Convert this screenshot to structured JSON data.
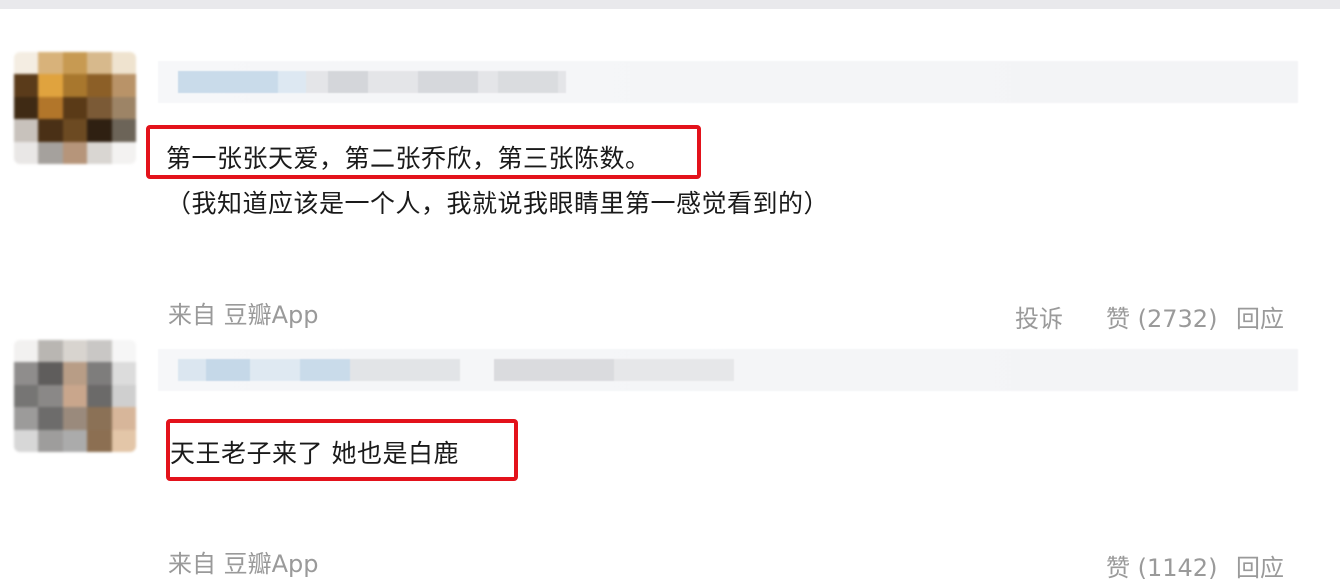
{
  "comments": [
    {
      "line1": "第一张张天爱，第二张乔欣，第三张陈数。",
      "line2": "（我知道应该是一个人，我就说我眼睛里第一感觉看到的）",
      "source": "来自 豆瓣App",
      "report_label": "投诉",
      "like_label": "赞 (2732)",
      "reply_label": "回应"
    },
    {
      "line1": "天王老子来了 她也是白鹿",
      "source": "来自 豆瓣App",
      "like_label": "赞 (1142)",
      "reply_label": "回应"
    }
  ],
  "colors": {
    "highlight": "#e3121b",
    "footer_text": "#9a9a9a",
    "meta_blur_blue": "#c9dbea",
    "meta_blur_gray": "#e2e3e6"
  },
  "icons": [
    "avatar-mosaic"
  ]
}
